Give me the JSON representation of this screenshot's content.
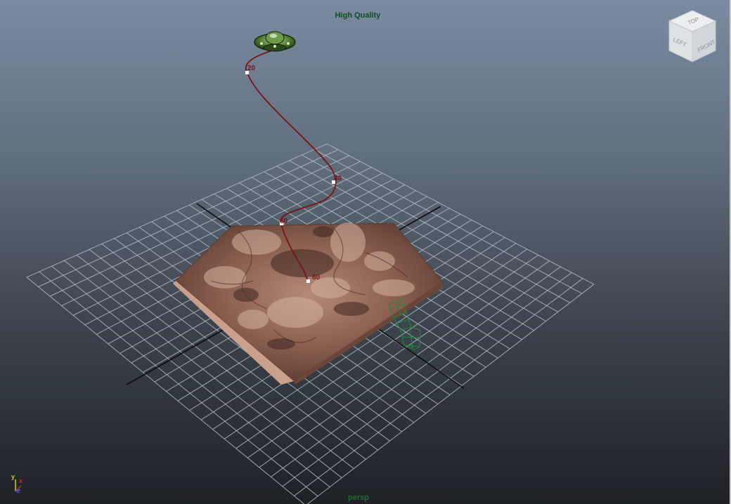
{
  "viewport": {
    "quality_mode": "High Quality",
    "camera": "persp"
  },
  "view_cube": {
    "faces": [
      "TOP",
      "LEFT",
      "FRONT"
    ]
  },
  "motion_path": {
    "frame_markers": [
      "20",
      "40",
      "60",
      "80"
    ]
  },
  "axis_indicator": {
    "axes": [
      "y",
      "x",
      "z"
    ],
    "colors": {
      "x": "#d8282b",
      "y": "#c8d400",
      "z": "#3b5bdb"
    }
  },
  "scene_objects": [
    {
      "name": "flying-saucer-icon"
    },
    {
      "name": "terrain-mesh"
    },
    {
      "name": "wireframe-object"
    }
  ]
}
